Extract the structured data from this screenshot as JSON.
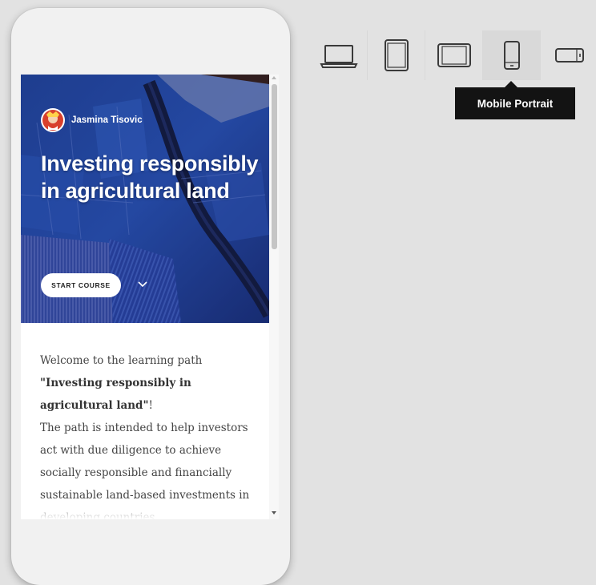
{
  "course": {
    "author": "Jasmina Tisovic",
    "title": "Investing responsibly in agricultural land",
    "start_button": "START COURSE",
    "description": {
      "intro": "Welcome to the learning path",
      "bold_title": "\"Investing responsibly in agricultural land\"",
      "bang": "!",
      "body": "The path is intended to help investors act with due diligence to achieve socially responsible and financially sustainable land-based investments in developing countries."
    }
  },
  "devices": {
    "items": [
      {
        "name": "laptop-icon",
        "active": false
      },
      {
        "name": "tablet-portrait-icon",
        "active": false
      },
      {
        "name": "tablet-landscape-icon",
        "active": false
      },
      {
        "name": "mobile-portrait-icon",
        "active": true
      },
      {
        "name": "mobile-landscape-icon",
        "active": false
      }
    ],
    "tooltip": "Mobile Portrait"
  },
  "colors": {
    "page_bg": "#e2e2e2",
    "hero_blue": "#1f3a8f",
    "tooltip_bg": "#131313"
  }
}
